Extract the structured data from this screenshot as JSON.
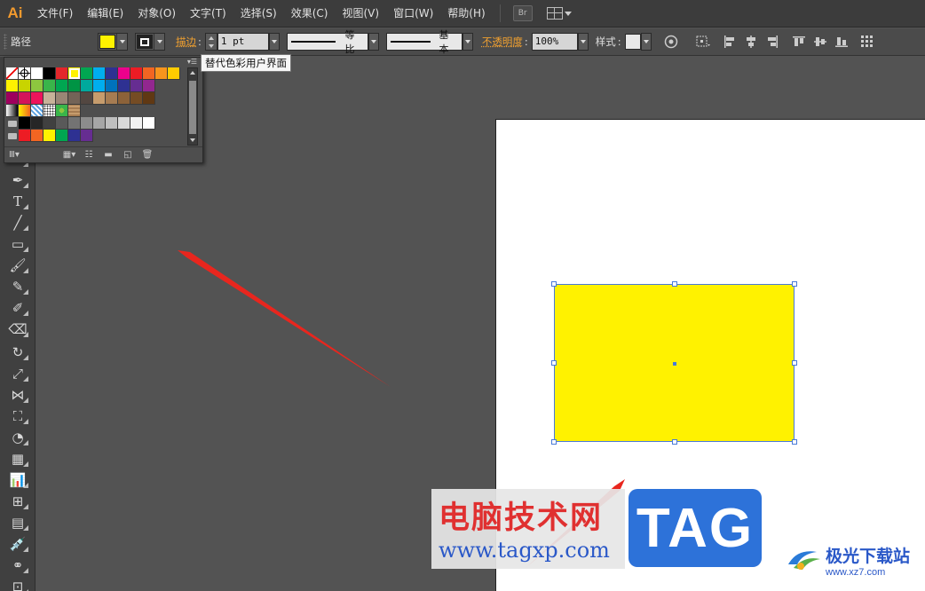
{
  "app": {
    "logo": "Ai"
  },
  "menu": [
    "文件(F)",
    "编辑(E)",
    "对象(O)",
    "文字(T)",
    "选择(S)",
    "效果(C)",
    "视图(V)",
    "窗口(W)",
    "帮助(H)"
  ],
  "menu_bridge": "Br",
  "control_bar": {
    "object_type": "路径",
    "fill_color": "#fff200",
    "stroke_label": "描边",
    "stroke_weight": "1 pt",
    "variable_width": "等比",
    "brush": "基本",
    "opacity_label": "不透明度",
    "opacity_value": "100%",
    "style_label": "样式"
  },
  "swatches_panel": {
    "tooltip": "替代色彩用户界面",
    "rows": [
      [
        "none",
        "reg",
        "#ffffff",
        "#000000",
        "#e4262b",
        "#fff200",
        "#00a651",
        "#00aeef",
        "#2e3192",
        "#ec008c",
        "#ed1c24",
        "#f26522",
        "#f7941d",
        "#ffcc00"
      ],
      [
        "#fff200",
        "#c8d400",
        "#8dc63f",
        "#39b54a",
        "#00a651",
        "#009444",
        "#00a99d",
        "#00aeef",
        "#0072bc",
        "#2e3192",
        "#662d91",
        "#92278f"
      ],
      [
        "#9e005d",
        "#d4145a",
        "#ed145b",
        "#c7b299",
        "#998675",
        "#736357",
        "#534741",
        "#c69c6d",
        "#a67c52",
        "#8c6239",
        "#754c24",
        "#603813"
      ],
      [
        "grad-bw",
        "grad-y",
        "pattern-blue",
        "pattern-dot",
        "pattern-green",
        "pattern-brown"
      ],
      [
        "folder",
        "#000000",
        "#262626",
        "#404040",
        "#595959",
        "#737373",
        "#8c8c8c",
        "#a6a6a6",
        "#bfbfbf",
        "#d9d9d9",
        "#f2f2f2",
        "#ffffff"
      ],
      [
        "folder",
        "#ed1c24",
        "#f26522",
        "#fff200",
        "#00a651",
        "#2e3192",
        "#662d91"
      ]
    ]
  },
  "artwork": {
    "fill": "#fff200",
    "selection_color": "#4a7ad8"
  },
  "watermarks": {
    "site_cn": "电脑技术网",
    "site_url": "www.tagxp.com",
    "tag": "TAG",
    "jg_cn": "极光下载站",
    "jg_url": "www.xz7.com"
  }
}
